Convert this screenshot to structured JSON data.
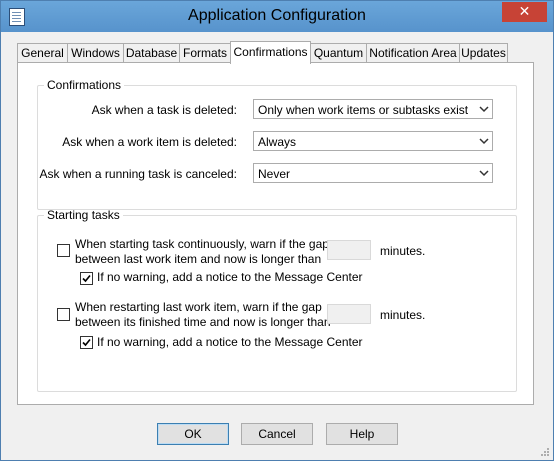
{
  "window": {
    "title": "Application Configuration",
    "close_glyph": "✕",
    "accent_color": "#5b9bd5",
    "close_color": "#c74336"
  },
  "tabs": [
    {
      "label": "General",
      "active": false
    },
    {
      "label": "Windows",
      "active": false
    },
    {
      "label": "Database",
      "active": false
    },
    {
      "label": "Formats",
      "active": false
    },
    {
      "label": "Confirmations",
      "active": true
    },
    {
      "label": "Quantum",
      "active": false
    },
    {
      "label": "Notification Area",
      "active": false
    },
    {
      "label": "Updates",
      "active": false
    }
  ],
  "confirmations": {
    "legend": "Confirmations",
    "rows": [
      {
        "label": "Ask when a task is deleted:",
        "value": "Only when work items or subtasks exist"
      },
      {
        "label": "Ask when a work item is deleted:",
        "value": "Always"
      },
      {
        "label": "Ask when a running task is canceled:",
        "value": "Never"
      }
    ]
  },
  "starting_tasks": {
    "legend": "Starting tasks",
    "option1": {
      "line1": "When starting task continuously, warn if the gap",
      "line2": "between last work item and now is longer than",
      "checked": false,
      "value": "",
      "unit": "minutes.",
      "sub_label": "If no warning, add a notice to the Message Center",
      "sub_checked": true
    },
    "option2": {
      "line1": "When restarting last work item, warn if the gap",
      "line2": "between its finished time and now is longer than",
      "checked": false,
      "value": "",
      "unit": "minutes.",
      "sub_label": "If no warning, add a notice to the Message Center",
      "sub_checked": true
    }
  },
  "buttons": {
    "ok": "OK",
    "cancel": "Cancel",
    "help": "Help"
  }
}
